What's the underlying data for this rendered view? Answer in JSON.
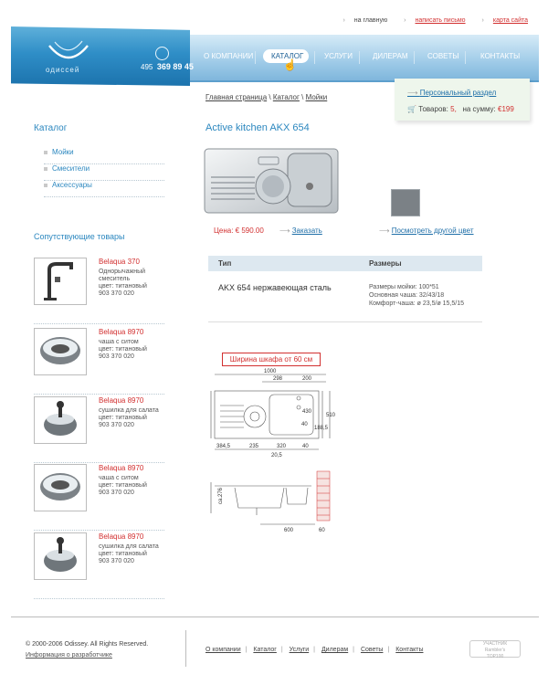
{
  "top_links": {
    "home": "на главную",
    "write_letter": "написать письмо",
    "site_map": "карта сайта"
  },
  "header": {
    "logo_text": "одиссей",
    "phone_code": "495",
    "phone_number": "369 89 45"
  },
  "nav": {
    "items": [
      {
        "label": "О КОМПАНИИ"
      },
      {
        "label": "КАТАЛОГ"
      },
      {
        "label": "УСЛУГИ"
      },
      {
        "label": "ДИЛЕРАМ"
      },
      {
        "label": "СОВЕТЫ"
      },
      {
        "label": "КОНТАКТЫ"
      }
    ],
    "active": "КАТАЛОГ"
  },
  "cart": {
    "personal": "Персональный раздел",
    "items_label": "Товаров:",
    "items_count": "5,",
    "sum_label": "на сумму:",
    "sum_value": "€199"
  },
  "breadcrumb": [
    "Главная страница",
    "Каталог",
    "Мойки"
  ],
  "sidebar": {
    "catalog_title": "Каталог",
    "catalog_items": [
      "Мойки",
      "Смесители",
      "Аксессуары"
    ],
    "related_title": "Сопутствующие товары",
    "related": [
      {
        "name": "Belaqua 370",
        "desc1": "Однорычажный смеситель",
        "desc2": "цвет: титановый",
        "code": "903 370 020",
        "icon": "faucet-icon"
      },
      {
        "name": "Belaqua 8970",
        "desc1": "чаша с ситом",
        "desc2": "цвет: титановый",
        "code": "903 370 020",
        "icon": "bowl-icon"
      },
      {
        "name": "Belaqua 8970",
        "desc1": "сушилка для салата",
        "desc2": "цвет: титановый",
        "code": "903 370 020",
        "icon": "salad-spinner-icon"
      },
      {
        "name": "Belaqua 8970",
        "desc1": "чаша с ситом",
        "desc2": "цвет: титановый",
        "code": "903 370 020",
        "icon": "bowl-icon"
      },
      {
        "name": "Belaqua 8970",
        "desc1": "сушилка для салата",
        "desc2": "цвет: титановый",
        "code": "903 370 020",
        "icon": "salad-spinner-icon"
      }
    ]
  },
  "product": {
    "title": "Active kitchen AKX 654",
    "price": "Цена: € 590.00",
    "order": "Заказать",
    "other_color": "Посмотреть другой цвет",
    "table": {
      "col_type": "Тип",
      "col_size": "Размеры",
      "model": "AKX 654 нержавеющая сталь",
      "sizes": [
        "Размеры мойки: 100*51",
        "Основная чаша: 32/43/18",
        "Комфорт-чаша: ø 23,5/ø 15,5/15"
      ]
    },
    "cabinet_note": "Ширина шкафа от 60 см",
    "drawing_top": {
      "labels": [
        "1000",
        "298",
        "200",
        "430",
        "510",
        "40",
        "188,5",
        "384,5",
        "235",
        "320",
        "40",
        "20,5"
      ]
    },
    "drawing_side": {
      "labels": [
        "ca.276",
        "600",
        "60"
      ]
    }
  },
  "footer": {
    "copyright": "© 2000-2006 Odissey. All Rights Reserved.",
    "dev_info": "Информация о разработчике",
    "links": [
      "О компании",
      "Каталог",
      "Услуги",
      "Дилерам",
      "Советы",
      "Контакты"
    ],
    "badge_line1": "УЧАСТНИК",
    "badge_line2": "Rambler's",
    "badge_line3": "TOP100"
  },
  "colors": {
    "accent": "#2b87bf",
    "red": "#d23030",
    "header_dark": "#1c73ad",
    "nav_light": "#d6ebf7"
  }
}
